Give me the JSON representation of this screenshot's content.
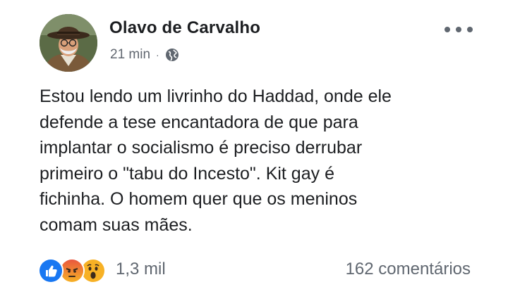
{
  "post": {
    "author": "Olavo de Carvalho",
    "time": "21 min",
    "separator": "·",
    "privacy_icon": "globe-icon",
    "more_icon": "more-options-icon",
    "text_lines": [
      "Estou lendo um livrinho do Haddad, onde ele",
      "defende a tese encantadora de que para",
      "implantar o socialismo é preciso derrubar",
      "primeiro o \"tabu do Incesto\". Kit gay é",
      "fichinha. O homem quer que os meninos",
      "comam suas mães."
    ],
    "reactions": {
      "icons": [
        "like-icon",
        "angry-icon",
        "wow-icon"
      ],
      "count": "1,3 mil"
    },
    "comments": "162 comentários"
  },
  "colors": {
    "text": "#1c1e21",
    "secondary": "#616770",
    "like_blue": "#1877f2",
    "angry_red": "#e9573f",
    "wow_yellow": "#f7b125"
  }
}
